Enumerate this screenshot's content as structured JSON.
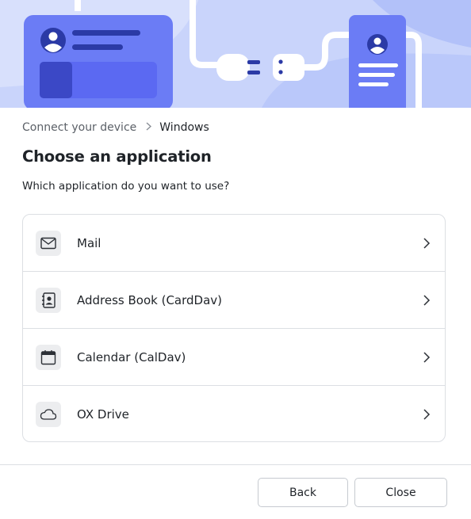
{
  "breadcrumb": {
    "parent": "Connect your device",
    "current": "Windows"
  },
  "title": "Choose an application",
  "subtitle": "Which application do you want to use?",
  "apps": [
    {
      "label": "Mail",
      "icon": "mail-icon"
    },
    {
      "label": "Address Book (CardDav)",
      "icon": "address-book-icon"
    },
    {
      "label": "Calendar (CalDav)",
      "icon": "calendar-icon"
    },
    {
      "label": "OX Drive",
      "icon": "cloud-icon"
    }
  ],
  "buttons": {
    "back": "Back",
    "close": "Close"
  },
  "colors": {
    "hero_bg": "#c9d4fb",
    "hero_accent": "#6b7cf5",
    "hero_dark": "#2b3aa6",
    "border": "#dcdfe3"
  }
}
